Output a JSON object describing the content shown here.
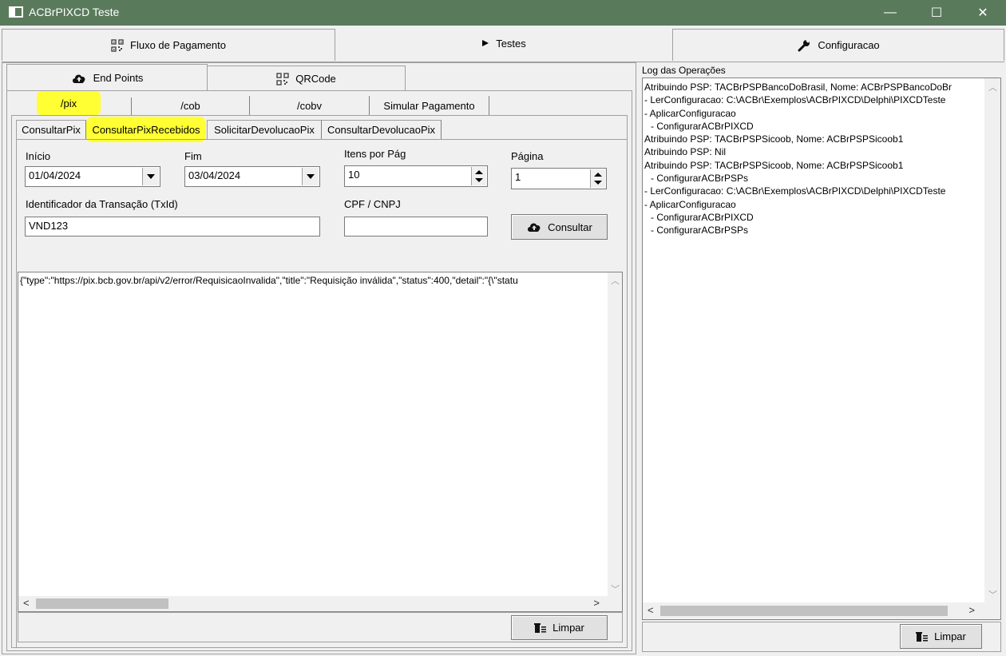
{
  "window": {
    "title": "ACBrPIXCD Teste",
    "minimize": "—",
    "maximize": "☐",
    "close": "✕"
  },
  "main_tabs": [
    {
      "label": "Fluxo de Pagamento",
      "icon": "qrcode-icon"
    },
    {
      "label": "Testes",
      "icon": "play-icon"
    },
    {
      "label": "Configuracao",
      "icon": "wrench-icon"
    }
  ],
  "sub_tabs": [
    {
      "label": "End Points",
      "icon": "cloud-icon"
    },
    {
      "label": "QRCode",
      "icon": "qrcode-icon"
    }
  ],
  "endpoint_tabs": [
    "/pix",
    "/cob",
    "/cobv",
    "Simular Pagamento"
  ],
  "pix_tabs": [
    "ConsultarPix",
    "ConsultarPixRecebidos",
    "SolicitarDevolucaoPix",
    "ConsultarDevolucaoPix"
  ],
  "form": {
    "inicio_label": "Início",
    "inicio_value": "01/04/2024",
    "fim_label": "Fim",
    "fim_value": "03/04/2024",
    "itens_label": "Itens por Pág",
    "itens_value": "10",
    "pagina_label": "Página",
    "pagina_value": "1",
    "txid_label": "Identificador da Transação (TxId)",
    "txid_value": "VND123",
    "cpf_label": "CPF / CNPJ",
    "cpf_value": "",
    "consultar_label": "Consultar"
  },
  "response_text": "{\"type\":\"https://pix.bcb.gov.br/api/v2/error/RequisicaoInvalida\",\"title\":\"Requisição inválida\",\"status\":400,\"detail\":\"{\\\"statu",
  "limpar_label": "Limpar",
  "log": {
    "title": "Log das Operações",
    "lines": [
      "Atribuindo PSP: TACBrPSPBancoDoBrasil, Nome: ACBrPSPBancoDoBr",
      "- LerConfiguracao: C:\\ACBr\\Exemplos\\ACBrPIXCD\\Delphi\\PIXCDTeste",
      "- AplicarConfiguracao",
      "  - ConfigurarACBrPIXCD",
      "Atribuindo PSP: TACBrPSPSicoob, Nome: ACBrPSPSicoob1",
      "Atribuindo PSP: Nil",
      "Atribuindo PSP: TACBrPSPSicoob, Nome: ACBrPSPSicoob1",
      "  - ConfigurarACBrPSPs",
      "- LerConfiguracao: C:\\ACBr\\Exemplos\\ACBrPIXCD\\Delphi\\PIXCDTeste",
      "- AplicarConfiguracao",
      "  - ConfigurarACBrPIXCD",
      "  - ConfigurarACBrPSPs"
    ],
    "limpar_label": "Limpar"
  }
}
